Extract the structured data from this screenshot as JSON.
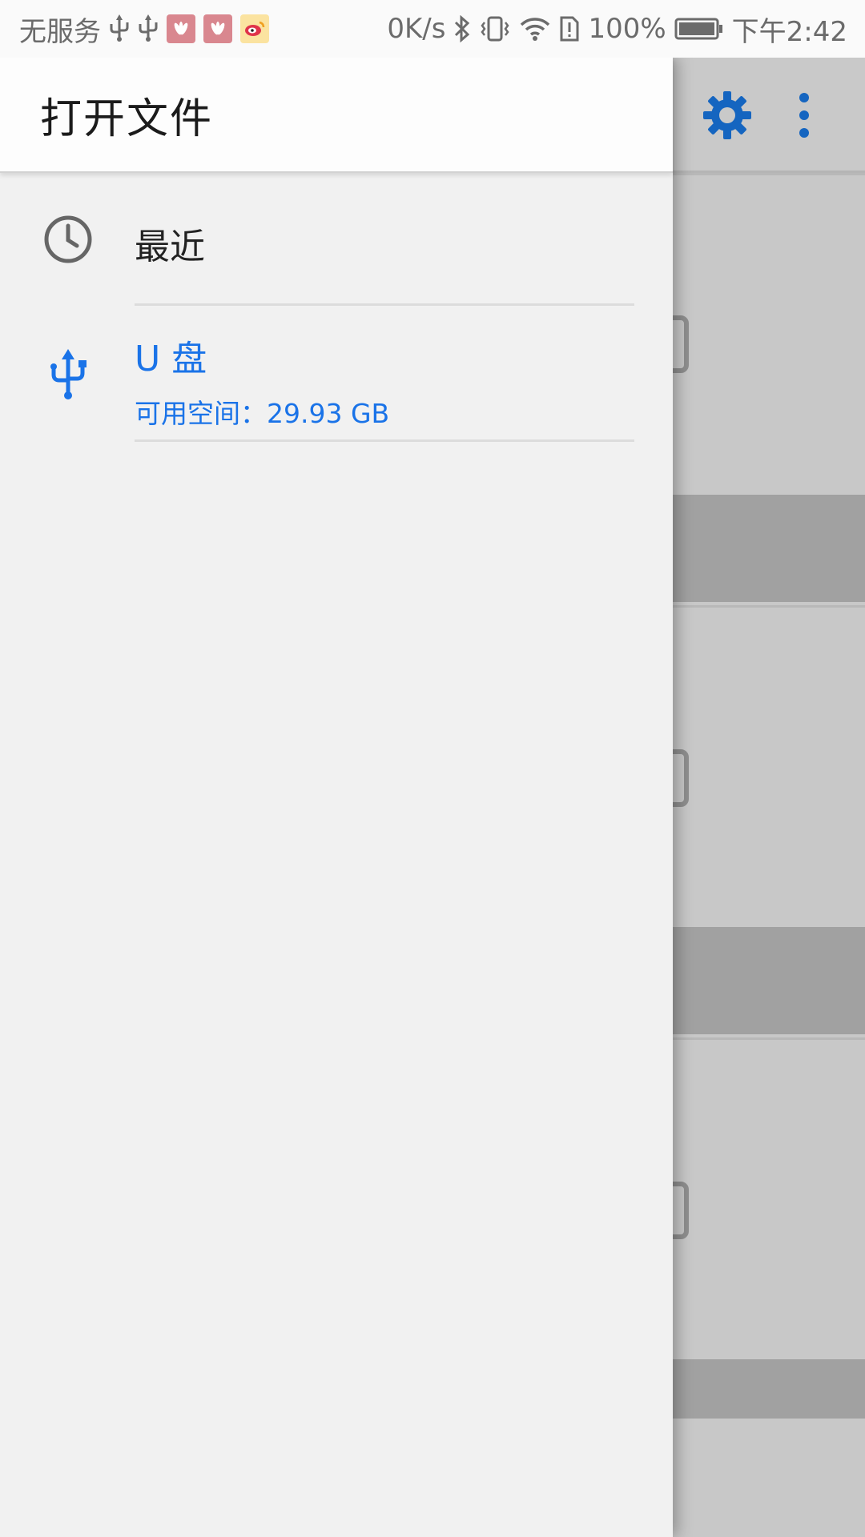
{
  "status_bar": {
    "carrier": "无服务",
    "left_icons": [
      "usb-icon",
      "usb-icon",
      "huawei-app-icon",
      "huawei-app-icon",
      "weibo-icon"
    ],
    "net_speed": "0K/s",
    "right_icons": [
      "bluetooth-icon",
      "vibrate-icon",
      "wifi-icon",
      "sim-alert-icon"
    ],
    "battery_percent": "100%",
    "time": "下午2:42"
  },
  "drawer": {
    "title": "打开文件",
    "roots": [
      {
        "icon": "clock-icon",
        "label": "最近"
      },
      {
        "icon": "usb-icon",
        "label": "U 盘",
        "summary": "可用空间：29.93 GB"
      }
    ]
  },
  "toolbar": {
    "icons": [
      "settings-gear-icon",
      "more-options-icon"
    ]
  },
  "colors": {
    "accent": "#1a73e8",
    "drawer_bg": "#f1f1f1",
    "scrim_bg": "#c8c8c8",
    "band": "#a1a1a1"
  }
}
